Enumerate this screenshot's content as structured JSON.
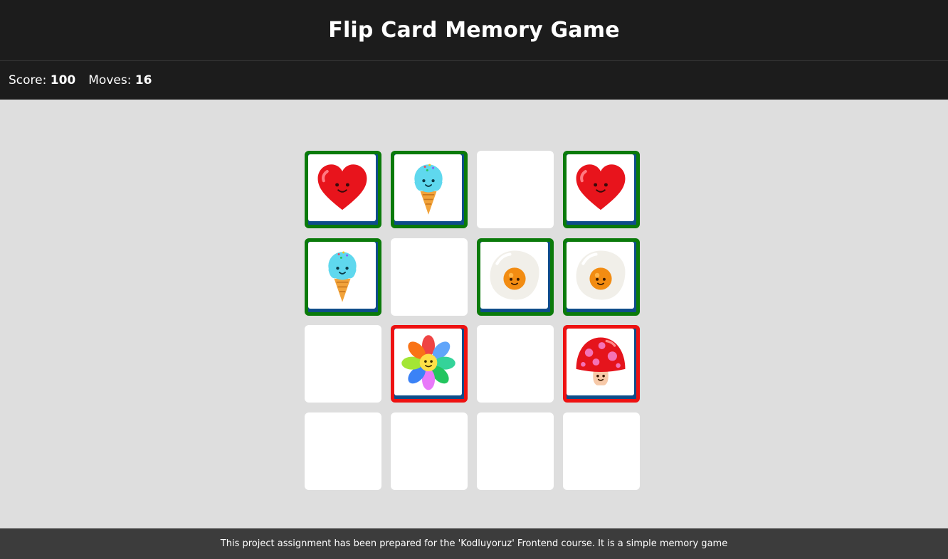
{
  "header": {
    "title": "Flip Card Memory Game"
  },
  "stats": {
    "score_label": "Score:",
    "score_value": "100",
    "moves_label": "Moves:",
    "moves_value": "16"
  },
  "board": {
    "rows": 4,
    "cols": 4,
    "cards": [
      {
        "state": "matched",
        "icon": "heart-icon"
      },
      {
        "state": "matched",
        "icon": "ice-cream-icon"
      },
      {
        "state": "hidden",
        "icon": ""
      },
      {
        "state": "matched",
        "icon": "heart-icon"
      },
      {
        "state": "matched",
        "icon": "ice-cream-icon"
      },
      {
        "state": "hidden",
        "icon": ""
      },
      {
        "state": "matched",
        "icon": "fried-egg-icon"
      },
      {
        "state": "matched",
        "icon": "fried-egg-icon"
      },
      {
        "state": "hidden",
        "icon": ""
      },
      {
        "state": "mismatch",
        "icon": "flower-icon"
      },
      {
        "state": "hidden",
        "icon": ""
      },
      {
        "state": "mismatch",
        "icon": "mushroom-icon"
      },
      {
        "state": "hidden",
        "icon": ""
      },
      {
        "state": "hidden",
        "icon": ""
      },
      {
        "state": "hidden",
        "icon": ""
      },
      {
        "state": "hidden",
        "icon": ""
      }
    ]
  },
  "colors": {
    "matched_border": "#0a7a0a",
    "mismatch_border": "#ee1111",
    "card_shadow": "#0e4d8a",
    "header_bg": "#1c1c1c",
    "board_bg": "#dedede",
    "footer_bg": "#3c3c3c"
  },
  "footer": {
    "text": "This project assignment has been prepared for the 'Kodluyoruz' Frontend course. It is a simple memory game"
  }
}
